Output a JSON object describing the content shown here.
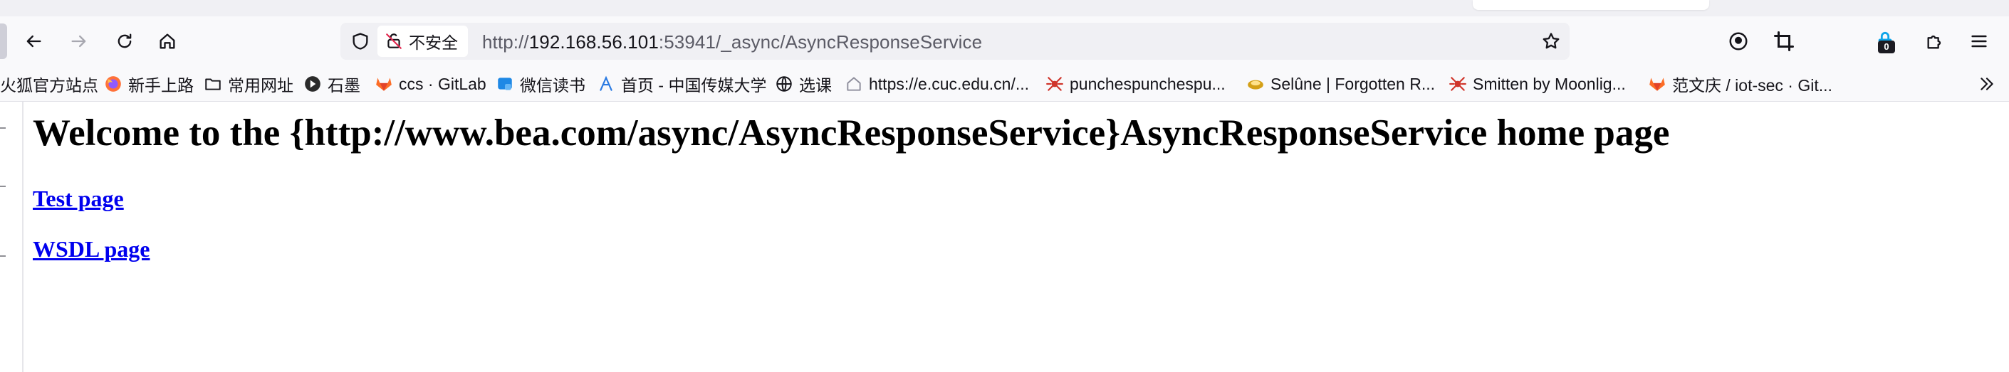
{
  "browser": {
    "urlbar": {
      "security_label": "不安全",
      "url_scheme": "http://",
      "url_host": "192.168.56.101",
      "url_path": ":53941/_async/AsyncResponseService"
    },
    "extensions_badge": "0",
    "bookmarks": [
      {
        "label": "火狐官方站点",
        "icon": "firefox-icon"
      },
      {
        "label": "新手上路",
        "icon": "firefox-icon"
      },
      {
        "label": "常用网址",
        "icon": "folder-icon"
      },
      {
        "label": "石墨",
        "icon": "shimo-icon"
      },
      {
        "label": "ccs · GitLab",
        "icon": "gitlab-icon"
      },
      {
        "label": "微信读书",
        "icon": "weread-icon"
      },
      {
        "label": "首页 - 中国传媒大学",
        "icon": "cuc-icon"
      },
      {
        "label": "选课",
        "icon": "globe-icon"
      },
      {
        "label": "https://e.cuc.edu.cn/...",
        "icon": "home-page-icon"
      },
      {
        "label": "punchespunchespu...",
        "icon": "spider-icon"
      },
      {
        "label": "Selûne | Forgotten R...",
        "icon": "selune-icon"
      },
      {
        "label": "Smitten by Moonlig...",
        "icon": "spider-icon"
      },
      {
        "label": "范文庆 / iot-sec · Git...",
        "icon": "gitlab-icon"
      }
    ]
  },
  "page": {
    "title": "Welcome to the {http://www.bea.com/async/AsyncResponseService}AsyncResponseService home page",
    "test_link": "Test page",
    "wsdl_link": "WSDL page"
  }
}
